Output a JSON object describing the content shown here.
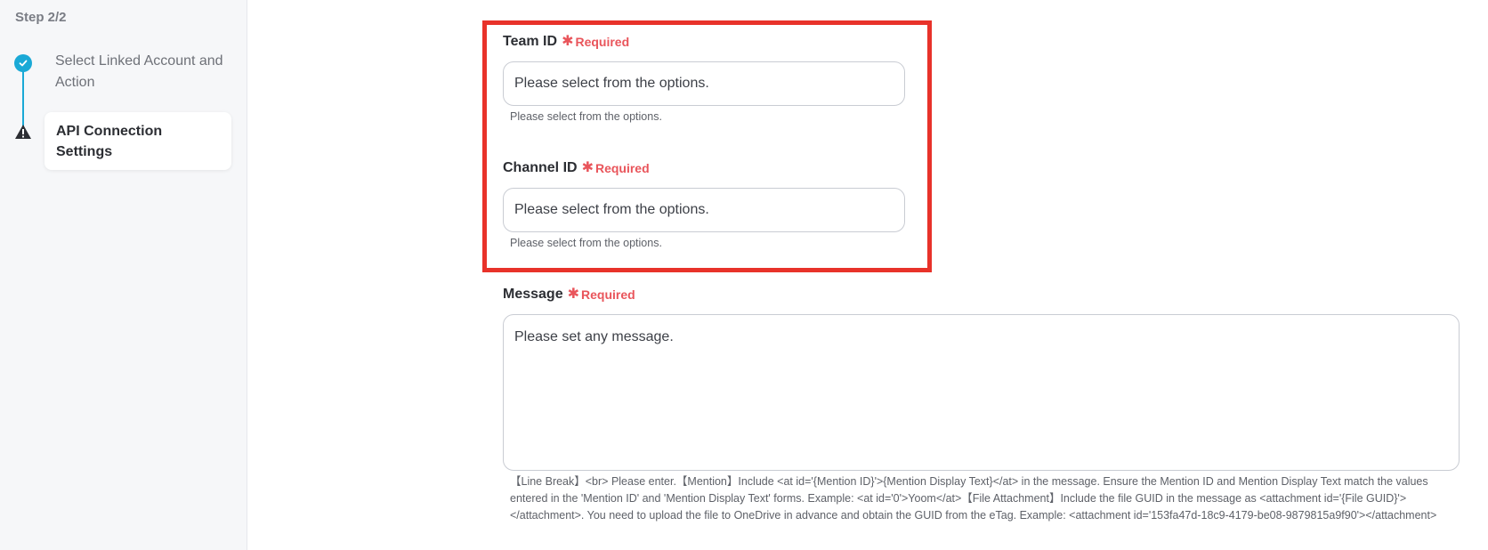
{
  "sidebar": {
    "step_label": "Step 2/2",
    "steps": [
      {
        "label": "Select Linked Account and Action",
        "status": "completed",
        "icon": "check-icon"
      },
      {
        "label": "API Connection Settings",
        "status": "warning",
        "icon": "warning-icon"
      }
    ],
    "accent_color": "#1aa9d6"
  },
  "form": {
    "required_text": "Required",
    "team_id": {
      "label": "Team ID",
      "placeholder": "Please select from the options.",
      "hint": "Please select from the options."
    },
    "channel_id": {
      "label": "Channel ID",
      "placeholder": "Please select from the options.",
      "hint": "Please select from the options."
    },
    "message": {
      "label": "Message",
      "placeholder": "Please set any message.",
      "hint": "【Line Break】<br> Please enter.【Mention】Include <at id='{Mention ID}'>{Mention Display Text}</at> in the message. Ensure the Mention ID and Mention Display Text match the values entered in the 'Mention ID' and 'Mention Display Text' forms. Example: <at id='0'>Yoom</at>【File Attachment】Include the file GUID in the message as <attachment id='{File GUID}'></attachment>. You need to upload the file to OneDrive in advance and obtain the GUID from the eTag. Example: <attachment id='153fa47d-18c9-4179-be08-9879815a9f90'></attachment>"
    },
    "required_color": "#e9555b",
    "highlight_color": "#e8322a"
  }
}
